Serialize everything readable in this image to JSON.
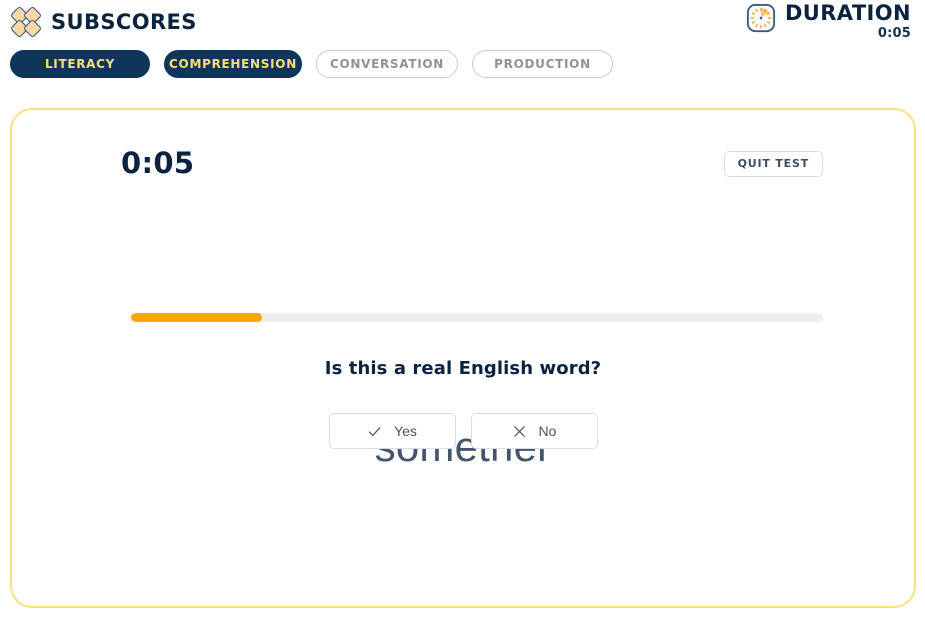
{
  "header": {
    "brand_title": "SUBSCORES",
    "brand_logo_icon": "diamond-cluster-logo-icon",
    "duration_label": "DURATION",
    "duration_value": "0:05",
    "duration_icon": "clock-timer-icon"
  },
  "tabs": [
    {
      "label": "LITERACY",
      "state": "active"
    },
    {
      "label": "COMPREHENSION",
      "state": "active"
    },
    {
      "label": "CONVERSATION",
      "state": "inactive"
    },
    {
      "label": "PRODUCTION",
      "state": "inactive"
    }
  ],
  "card": {
    "timer": "0:05",
    "quit_label": "QUIT TEST",
    "progress_percent": 19,
    "question": "Is this a real English word?",
    "prompt_word": "somether",
    "answers": [
      {
        "label": "Yes",
        "icon": "check-icon"
      },
      {
        "label": "No",
        "icon": "cross-icon"
      }
    ]
  },
  "colors": {
    "navy": "#10355a",
    "navy_text": "#0c2340",
    "tab_active_text": "#fbe07a",
    "tab_inactive_text": "#8c939d",
    "orange": "#faa705",
    "card_border": "#f7e27f",
    "slate": "#44546a",
    "logo_fill": "#fbd7a8"
  }
}
